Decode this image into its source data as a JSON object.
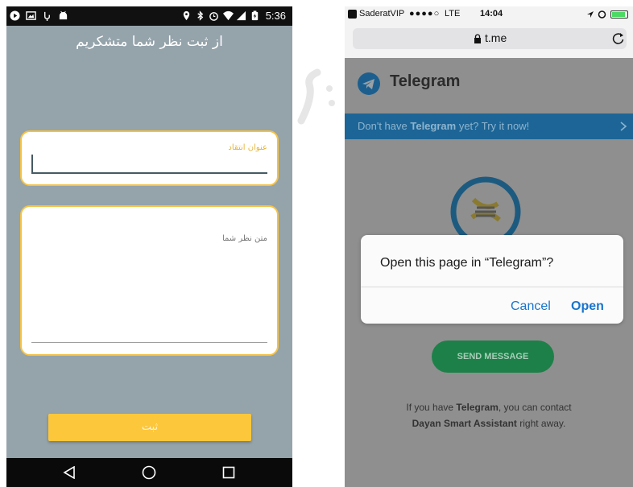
{
  "android": {
    "status_time": "5:36",
    "header_text": "از ثبت نظر شما متشکریم",
    "title_field": {
      "label": "عنوان انتقاد",
      "value": ""
    },
    "body_field": {
      "label": "متن نظر شما",
      "value": ""
    },
    "submit_label": "ثبت",
    "icons": [
      "play-icon",
      "image-icon",
      "usb-icon",
      "android-icon",
      "location-icon",
      "bluetooth-icon",
      "alarm-icon",
      "wifi-icon",
      "signal-icon",
      "battery-icon",
      "back-icon",
      "home-icon",
      "recents-icon"
    ],
    "colors": {
      "background": "#95a3ab",
      "accent": "#f5c243",
      "button": "#fdc73c"
    }
  },
  "ios": {
    "status": {
      "carrier": "SaderatVIP",
      "network": "LTE",
      "time": "14:04"
    },
    "url": "t.me",
    "app_name": "Telegram",
    "banner": {
      "prefix": "Don't have ",
      "brand": "Telegram",
      "suffix": " yet? Try it now!"
    },
    "dialog": {
      "question": "Open this page in “Telegram”?",
      "cancel_label": "Cancel",
      "open_label": "Open"
    },
    "send_label": "SEND MESSAGE",
    "footer": {
      "line1_prefix": "If you have ",
      "line1_brand": "Telegram",
      "line1_suffix": ", you can contact",
      "line2_name": "Dayan Smart Assistant",
      "line2_suffix": " right away."
    },
    "icons": [
      "lock-icon",
      "reload-icon",
      "telegram-logo-icon",
      "chevron-right-icon",
      "dna-logo-icon",
      "location-arrow-icon",
      "alarm-icon",
      "battery-icon"
    ],
    "colors": {
      "banner": "#1d6596",
      "link": "#1874cd",
      "send_button": "#1e8049"
    }
  }
}
